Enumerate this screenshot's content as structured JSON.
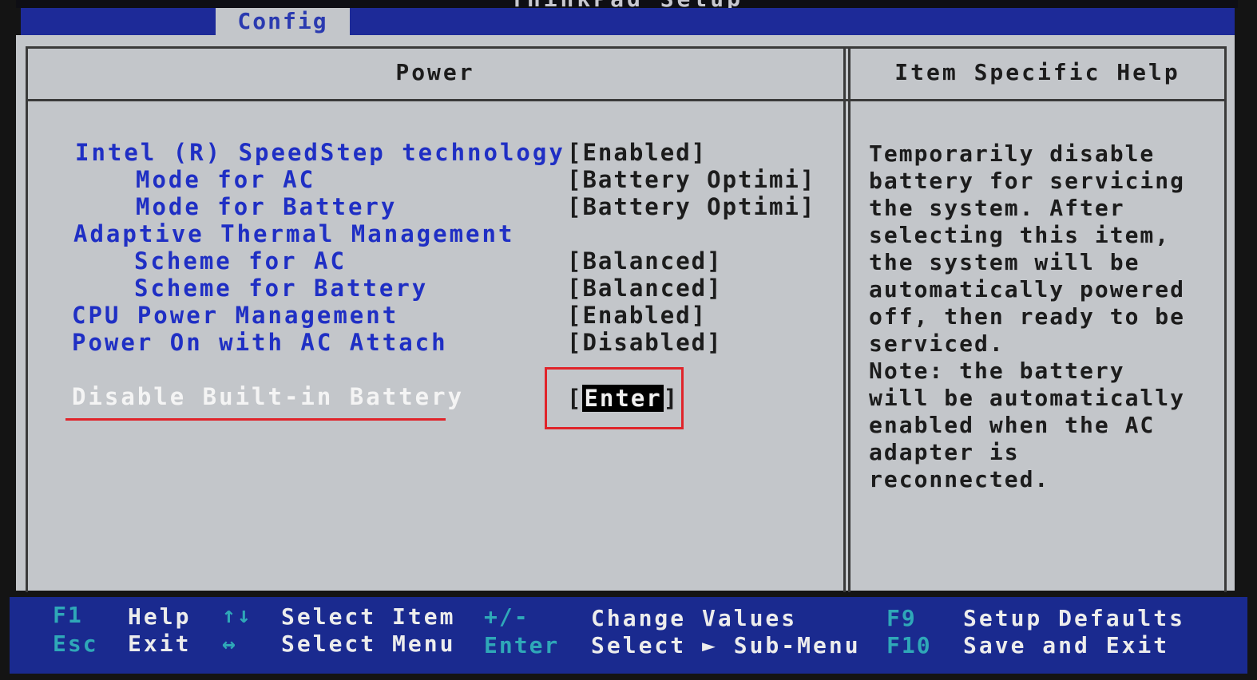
{
  "window": {
    "title": "ThinkPad Setup"
  },
  "tabs": {
    "active": "Config"
  },
  "columns": {
    "left_title": "Power",
    "right_title": "Item Specific Help"
  },
  "settings": [
    {
      "label": "Intel (R) SpeedStep technology",
      "value": "[Enabled]"
    },
    {
      "label": "Mode for AC",
      "value": "[Battery Optimi]"
    },
    {
      "label": "Mode for Battery",
      "value": "[Battery Optimi]"
    },
    {
      "label": "Adaptive Thermal Management",
      "value": ""
    },
    {
      "label": "Scheme for AC",
      "value": "[Balanced]"
    },
    {
      "label": "Scheme for Battery",
      "value": "[Balanced]"
    },
    {
      "label": "CPU Power Management",
      "value": "[Enabled]"
    },
    {
      "label": "Power On with AC Attach",
      "value": "[Disabled]"
    }
  ],
  "selected": {
    "label": "Disable Built-in Battery",
    "bracket_open": "[",
    "value": "Enter",
    "bracket_close": "]"
  },
  "help": {
    "lines": [
      "Temporarily disable",
      "battery for servicing",
      "the system. After",
      "selecting this item,",
      "the system will be",
      "automatically powered",
      "off, then ready to be",
      "serviced.",
      "Note: the battery",
      "will be automatically",
      "enabled when the AC",
      "adapter is",
      "reconnected."
    ]
  },
  "footer": {
    "f1_key": "F1",
    "f1_desc": "Help",
    "esc_key": "Esc",
    "esc_desc": "Exit",
    "updown_key": "↑↓",
    "updown_desc": "Select Item",
    "leftright_key": "↔",
    "leftright_desc": "Select Menu",
    "plusminus_key": "+/-",
    "plusminus_desc": "Change Values",
    "enter_key": "Enter",
    "enter_desc": "Select ► Sub-Menu",
    "f9_key": "F9",
    "f9_desc": "Setup Defaults",
    "f10_key": "F10",
    "f10_desc": "Save and Exit"
  },
  "colors": {
    "menu_blue": "#1f2fc4",
    "bar_blue": "#1a2a8f",
    "panel_gray": "#c3c6ca",
    "annotation_red": "#e0242a",
    "key_cyan": "#2fa8b8"
  }
}
